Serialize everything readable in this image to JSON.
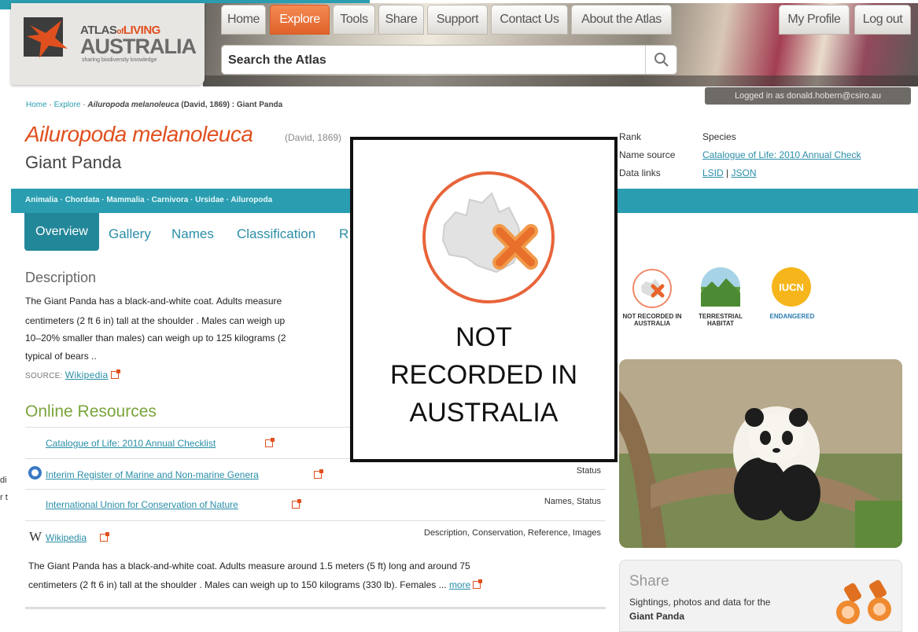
{
  "header": {
    "logo": {
      "line1_a": "ATLAS",
      "line1_b": "of",
      "line1_c": "LIVING",
      "line2": "AUSTRALIA",
      "tagline": "sharing biodiversity knowledge"
    },
    "nav": [
      "Home",
      "Explore",
      "Tools",
      "Share",
      "Support",
      "Contact Us",
      "About the Atlas"
    ],
    "active_nav": "Explore",
    "user_nav": [
      "My Profile",
      "Log out"
    ],
    "search_placeholder": "Search the Atlas",
    "logged_in": "Logged in as donald.hobern@csiro.au",
    "colors": {
      "accent": "#2a9eb0",
      "brand_orange": "#e0501f"
    }
  },
  "breadcrumb": {
    "items": [
      "Home",
      "Explore"
    ],
    "current": "Ailuropoda melanoleuca",
    "current_rest": " (David, 1869) : Giant Panda"
  },
  "species": {
    "scientific_name": "Ailuropoda melanoleuca",
    "author": "(David, 1869)",
    "common_name": "Giant Panda",
    "rank_label": "Rank",
    "rank_value": "Species",
    "name_source_label": "Name source",
    "name_source_value": "Catalogue of Life: 2010 Annual Check",
    "data_links_label": "Data links",
    "data_link_lsid": "LSID",
    "data_link_sep": " | ",
    "data_link_json": "JSON"
  },
  "taxonomy": "Animalia · Chordata · Mammalia · Carnivora · Ursidae · Ailuropoda",
  "tabs": {
    "active": "Overview",
    "items": [
      "Gallery",
      "Names",
      "Classification",
      "R"
    ]
  },
  "description": {
    "title": "Description",
    "lines": [
      "The Giant Panda has a black-and-white coat. Adults measure",
      "centimeters (2 ft 6 in) tall at the shoulder . Males can weigh up",
      "10–20% smaller than males) can weigh up to 125 kilograms (2",
      "typical of bears .."
    ],
    "source_label": "SOURCE:",
    "source_link": "Wikipedia"
  },
  "online_resources": {
    "title": "Online Resources",
    "rows": [
      {
        "name": "Catalogue of Life: 2010 Annual Checklist",
        "tags": ""
      },
      {
        "name": "Interim Register of Marine and Non-marine Genera",
        "tags": "Status"
      },
      {
        "name": "International Union for Conservation of Nature",
        "tags": "Names, Status"
      },
      {
        "name": "Wikipedia",
        "tags": "Description, Conservation, Reference, Images"
      }
    ],
    "wiki_w": "W",
    "wiki_text_1": "The Giant Panda has a black-and-white coat. Adults measure around 1.5 meters (5 ft) long and around 75",
    "wiki_text_2": "centimeters (2 ft 6 in) tall at the shoulder . Males can weigh up to 150 kilograms (330 lb). Females ...",
    "more_link": "more"
  },
  "edge_fragments": [
    "di",
    "r t"
  ],
  "status_icons": [
    {
      "caption": "NOT RECORDED IN AUSTRALIA"
    },
    {
      "caption": "TERRESTRIAL HABITAT"
    },
    {
      "caption": "ENDANGERED",
      "badge": "IUCN"
    }
  ],
  "share": {
    "title": "Share",
    "text": "Sightings, photos and data for the",
    "species": "Giant Panda"
  },
  "overlay": {
    "line1": "NOT",
    "line2": "RECORDED IN",
    "line3": "AUSTRALIA"
  }
}
